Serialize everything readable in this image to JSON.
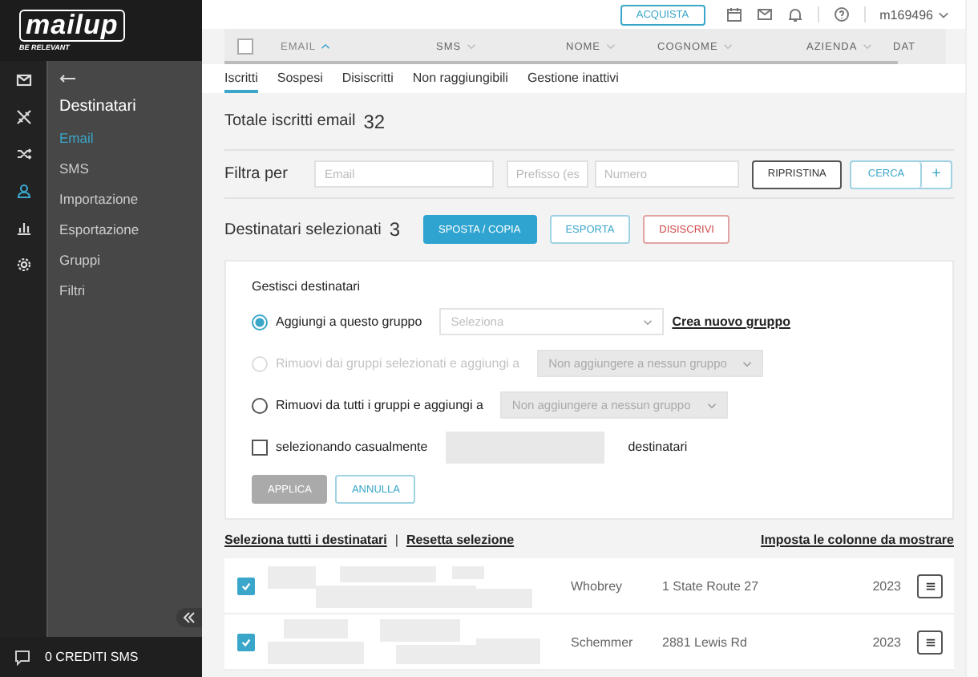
{
  "logo": {
    "name": "mailup",
    "tagline": "BE RELEVANT"
  },
  "rail": [
    {
      "selected": false
    },
    {
      "selected": false
    },
    {
      "selected": false
    },
    {
      "selected": true
    },
    {
      "selected": false
    },
    {
      "selected": false
    }
  ],
  "sidebar": {
    "title": "Destinatari",
    "items": [
      {
        "label": "Email",
        "selected": true
      },
      {
        "label": "SMS",
        "selected": false
      },
      {
        "label": "Importazione",
        "selected": false
      },
      {
        "label": "Esportazione",
        "selected": false
      },
      {
        "label": "Gruppi",
        "selected": false
      },
      {
        "label": "Filtri",
        "selected": false
      }
    ],
    "footer": "0 CREDITI SMS"
  },
  "header": {
    "buy_button": "ACQUISTA",
    "user": "m169496"
  },
  "table_header": {
    "checked": false,
    "columns": [
      {
        "label": "EMAIL",
        "sorted": true
      },
      {
        "label": "SMS",
        "sorted": false
      },
      {
        "label": "NOME",
        "sorted": false
      },
      {
        "label": "COGNOME",
        "sorted": false
      },
      {
        "label": "AZIENDA",
        "sorted": false
      },
      {
        "label": "DAT",
        "sorted": false
      }
    ]
  },
  "tabs": [
    {
      "label": "Iscritti",
      "selected": true
    },
    {
      "label": "Sospesi",
      "selected": false
    },
    {
      "label": "Disiscritti",
      "selected": false
    },
    {
      "label": "Non raggiungibili",
      "selected": false
    },
    {
      "label": "Gestione inattivi",
      "selected": false
    }
  ],
  "total": {
    "label": "Totale iscritti email",
    "count": "32"
  },
  "filter": {
    "label": "Filtra per",
    "fields": [
      {
        "placeholder": "Email"
      },
      {
        "placeholder": "Prefisso (es"
      },
      {
        "placeholder": "Numero"
      }
    ],
    "reset": "RIPRISTINA",
    "search": "CERCA",
    "add": "+"
  },
  "selected": {
    "label": "Destinatari selezionati",
    "count": "3",
    "buttons": [
      {
        "label": "SPOSTA / COPIA",
        "kind": "primary"
      },
      {
        "label": "ESPORTA",
        "kind": "outline"
      },
      {
        "label": "DISISCRIVI",
        "kind": "danger"
      }
    ]
  },
  "manage": {
    "title": "Gestisci destinatari",
    "options": [
      {
        "label": "Aggiungi a questo gruppo",
        "selected": true,
        "disabled": false,
        "dropdown": {
          "placeholder": "Seleziona",
          "disabled": false
        },
        "link": "Crea nuovo gruppo"
      },
      {
        "label": "Rimuovi dai gruppi selezionati e aggiungi a",
        "selected": false,
        "disabled": true,
        "dropdown": {
          "value": "Non aggiungere a nessun gruppo",
          "disabled": true
        }
      },
      {
        "label": "Rimuovi da tutti i gruppi e aggiungi a",
        "selected": false,
        "disabled": false,
        "dropdown": {
          "value": "Non aggiungere a nessun gruppo",
          "disabled": true
        }
      }
    ],
    "random": {
      "checked": false,
      "label": "selezionando casualmente",
      "suffix": "destinatari"
    },
    "apply": {
      "label": "APPLICA",
      "disabled": true
    },
    "cancel": "ANNULLA"
  },
  "links": {
    "select_all": "Seleziona tutti i destinatari",
    "separator": "|",
    "reset": "Resetta selezione",
    "columns": "Imposta le colonne da mostrare"
  },
  "rows": [
    {
      "checked": true,
      "surname": "Whobrey",
      "address": "1 State Route 27",
      "date": "2023"
    },
    {
      "checked": true,
      "surname": "Schemmer",
      "address": "2881 Lewis Rd",
      "date": "2023"
    }
  ]
}
